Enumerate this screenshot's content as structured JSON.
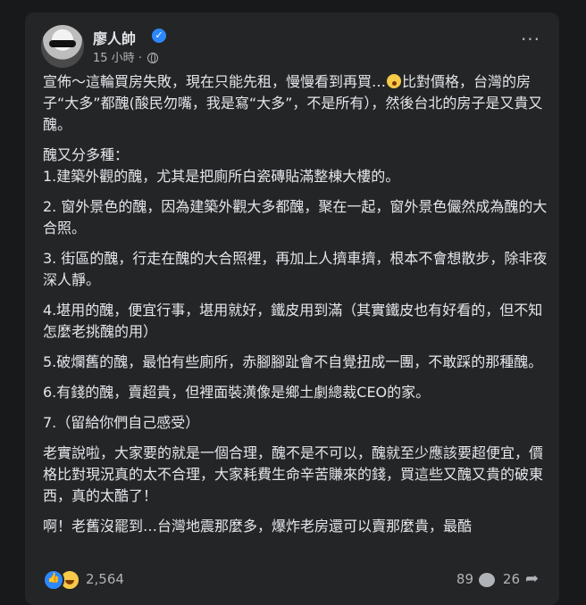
{
  "post": {
    "author": "廖人帥",
    "time": "15 小時",
    "separator": "·",
    "paragraphs": [
      {
        "before": "宣佈～這輪買房失敗，現在只能先租，慢慢看到再買…",
        "after": "比對價格，台灣的房子“大多”都醜(酸民勿嘴，我是寫“大多”，不是所有），然後台北的房子是又貴又醜。"
      },
      "醜又分多種：",
      "1.建築外觀的醜，尤其是把廁所白瓷磚貼滿整棟大樓的。",
      "2. 窗外景色的醜，因為建築外觀大多都醜，聚在一起，窗外景色儼然成為醜的大合照。",
      "3. 街區的醜，行走在醜的大合照裡，再加上人擠車擠，根本不會想散步，除非夜深人靜。",
      "4.堪用的醜，便宜行事，堪用就好，鐵皮用到滿（其實鐵皮也有好看的，但不知怎麼老挑醜的用）",
      "5.破爛舊的醜，最怕有些廁所，赤腳腳趾會不自覺扭成一團，不敢踩的那種醜。",
      "6.有錢的醜，賣超貴，但裡面裝潢像是鄉土劇總裁CEO的家。",
      "7.（留給你們自己感受）",
      "老實說啦，大家要的就是一個合理，醜不是不可以，醜就至少應該要超便宜，價格比對現況真的太不合理，大家耗費生命辛苦賺來的錢，買這些又醜又貴的破東西，真的太酷了！",
      "啊！老舊沒罷到…台灣地震那麼多，爆炸老房還可以賣那麼貴，最酷"
    ]
  },
  "reactions": {
    "count": "2,564",
    "comments": "89",
    "shares": "26"
  },
  "icons": {
    "verified": "verified-badge-icon",
    "audience": "globe-icon",
    "more": "more-options-icon",
    "like": "like-reaction-icon",
    "haha": "haha-reaction-icon",
    "comment": "comment-icon",
    "share": "share-icon"
  },
  "colors": {
    "background": "#18191a",
    "card": "#242526",
    "text": "#e4e6eb",
    "secondary": "#b0b3b8",
    "accent": "#2d88ff"
  }
}
